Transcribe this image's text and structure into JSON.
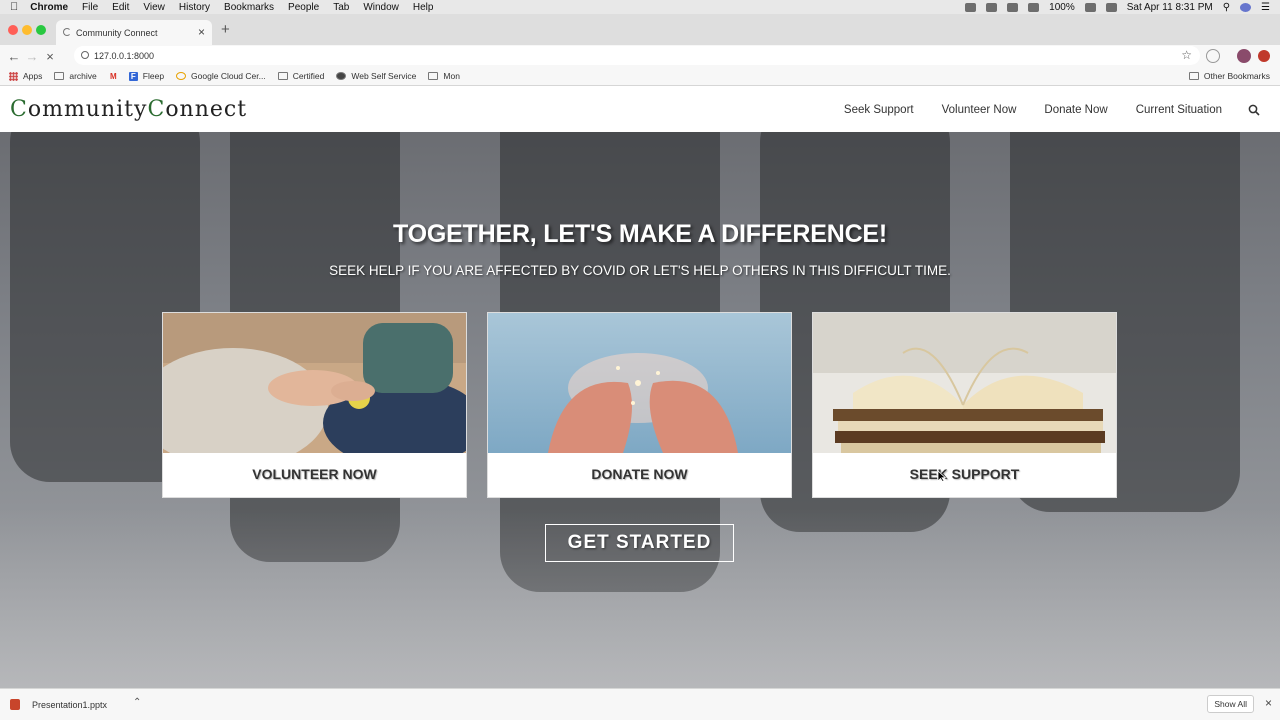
{
  "mac_menubar": {
    "app_name": "Chrome",
    "menus": [
      "File",
      "Edit",
      "View",
      "History",
      "Bookmarks",
      "People",
      "Tab",
      "Window",
      "Help"
    ],
    "battery": "100%",
    "datetime": "Sat Apr 11  8:31 PM"
  },
  "browser": {
    "tab_title": "Community Connect",
    "url": "127.0.0.1:8000",
    "bookmarks": [
      "Apps",
      "archive",
      "Fleep",
      "Google Cloud Cer...",
      "Certified",
      "Web Self Service",
      "Mon"
    ],
    "other_bookmarks": "Other Bookmarks"
  },
  "site": {
    "logo_part1": "C",
    "logo_part2": "ommunity",
    "logo_part3": "C",
    "logo_part4": "onnect",
    "nav": [
      "Seek Support",
      "Volunteer Now",
      "Donate Now",
      "Current Situation"
    ]
  },
  "hero": {
    "title": "TOGETHER, LET'S MAKE A DIFFERENCE!",
    "subtitle": "SEEK HELP IF YOU ARE AFFECTED BY COVID OR LET'S HELP OTHERS IN THIS DIFFICULT TIME.",
    "cards": [
      {
        "label": "VOLUNTEER NOW"
      },
      {
        "label": "DONATE NOW"
      },
      {
        "label": "SEEK SUPPORT"
      }
    ],
    "cta": "GET STARTED"
  },
  "downloads": {
    "file": "Presentation1.pptx",
    "show_all": "Show All"
  },
  "colors": {
    "logo_accent": "#2b6b30",
    "text": "#333333"
  }
}
